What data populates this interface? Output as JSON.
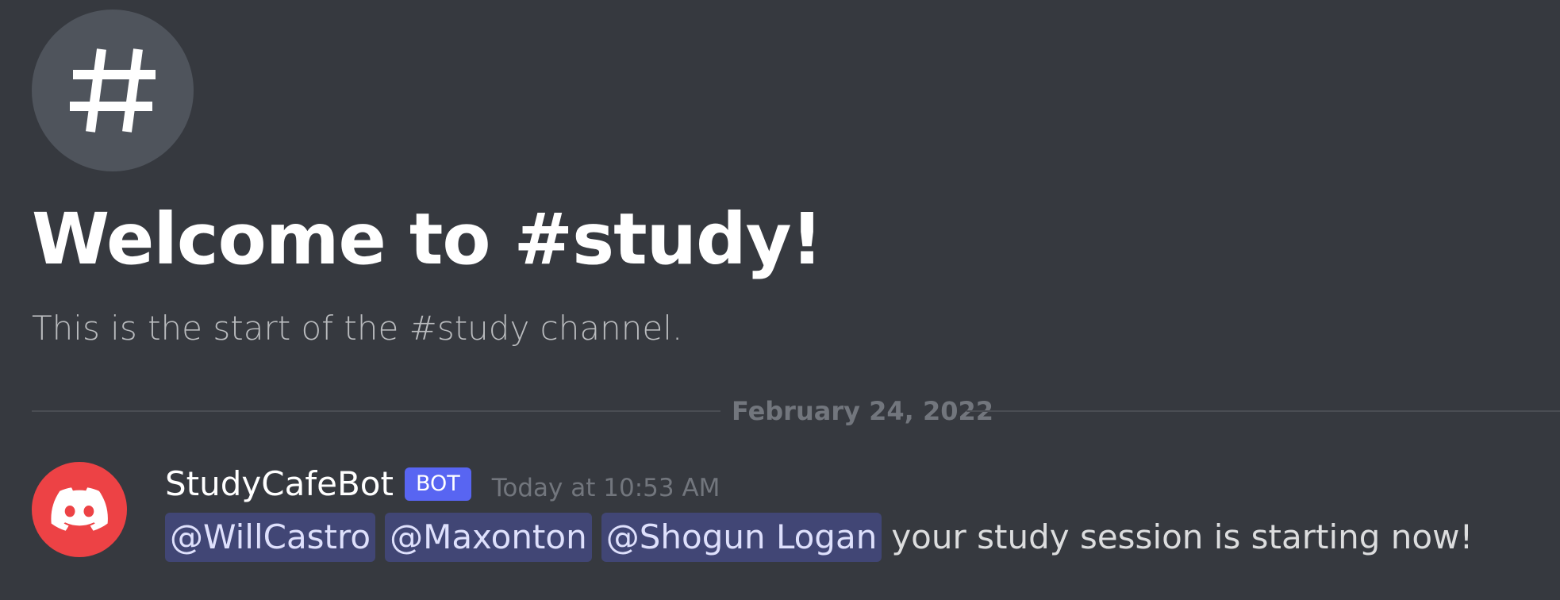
{
  "channel": {
    "icon": "hashtag-icon",
    "welcome_title": "Welcome to #study!",
    "welcome_subtitle": "This is the start of the #study channel."
  },
  "divider": {
    "date": "February 24, 2022"
  },
  "message": {
    "avatar_icon": "discord-logo-icon",
    "author": "StudyCafeBot",
    "bot_tag": "BOT",
    "timestamp": "Today at 10:53 AM",
    "mentions": [
      "@WillCastro",
      "@Maxonton",
      "@Shogun Logan"
    ],
    "text": "your study session is starting now!"
  },
  "colors": {
    "background": "#36393f",
    "channel_icon_bg": "#4f545c",
    "bot_tag": "#5865f2",
    "avatar_bg": "#ed4245",
    "mention_bg": "#414675",
    "mention_text": "#dee0fc"
  }
}
